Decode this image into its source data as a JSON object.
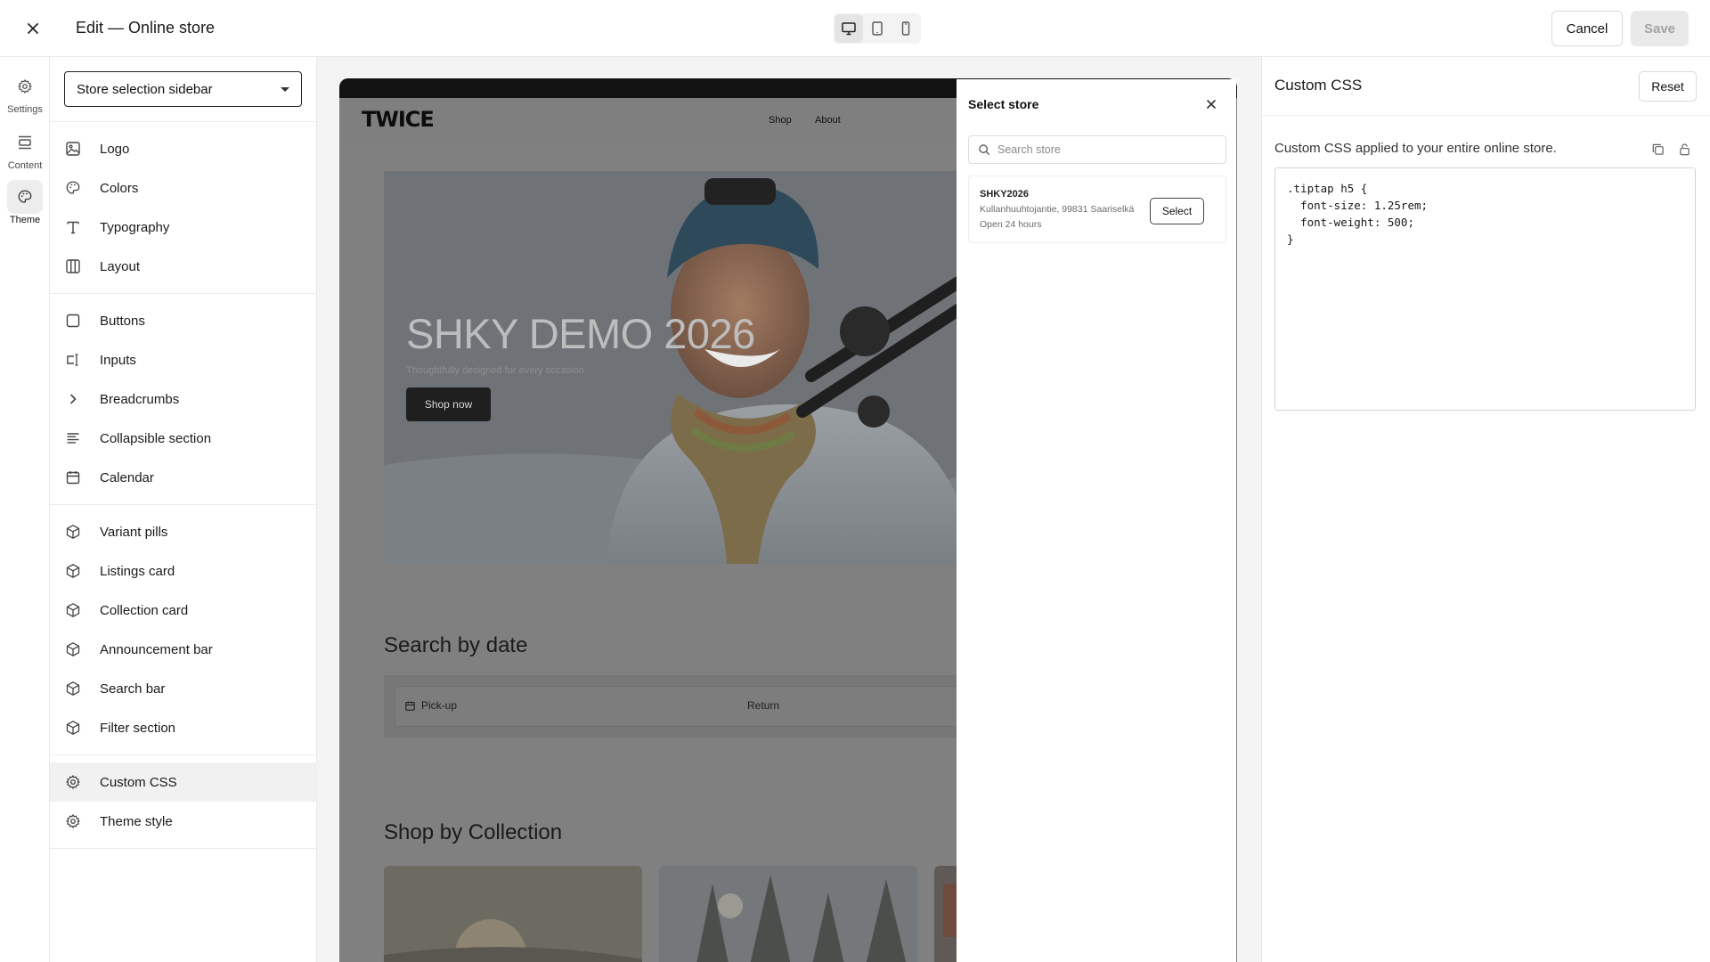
{
  "topbar": {
    "title": "Edit — Online store",
    "device_modes": [
      "desktop",
      "tablet",
      "mobile"
    ],
    "active_device": "desktop",
    "cancel_label": "Cancel",
    "save_label": "Save"
  },
  "rail": {
    "items": [
      {
        "label": "Settings",
        "icon": "gear-icon"
      },
      {
        "label": "Content",
        "icon": "content-icon"
      },
      {
        "label": "Theme",
        "icon": "palette-icon",
        "active": true
      }
    ]
  },
  "sidebar": {
    "dropdown_value": "Store selection sidebar",
    "groups": [
      [
        {
          "label": "Logo",
          "icon": "image-icon"
        },
        {
          "label": "Colors",
          "icon": "palette-icon"
        },
        {
          "label": "Typography",
          "icon": "type-icon"
        },
        {
          "label": "Layout",
          "icon": "columns-icon"
        }
      ],
      [
        {
          "label": "Buttons",
          "icon": "square-icon"
        },
        {
          "label": "Inputs",
          "icon": "input-cursor-icon"
        },
        {
          "label": "Breadcrumbs",
          "icon": "chevron-right-icon"
        },
        {
          "label": "Collapsible section",
          "icon": "align-left-icon"
        },
        {
          "label": "Calendar",
          "icon": "calendar-icon"
        }
      ],
      [
        {
          "label": "Variant pills",
          "icon": "box-icon"
        },
        {
          "label": "Listings card",
          "icon": "box-icon"
        },
        {
          "label": "Collection card",
          "icon": "box-icon"
        },
        {
          "label": "Announcement bar",
          "icon": "box-icon"
        },
        {
          "label": "Search bar",
          "icon": "box-icon"
        },
        {
          "label": "Filter section",
          "icon": "box-icon"
        }
      ],
      [
        {
          "label": "Custom CSS",
          "icon": "gear-icon",
          "active": true
        },
        {
          "label": "Theme style",
          "icon": "gear-icon"
        }
      ]
    ]
  },
  "preview": {
    "logo": "TWICE",
    "nav": [
      "Shop",
      "About"
    ],
    "hero_title": "SHKY DEMO 2026",
    "hero_subtitle": "Thoughtfully designed for every occasion",
    "hero_button": "Shop now",
    "search_by_date_title": "Search by date",
    "pickup_label": "Pick-up",
    "return_label": "Return",
    "collection_title": "Shop by Collection"
  },
  "store_drawer": {
    "title": "Select store",
    "search_placeholder": "Search store",
    "stores": [
      {
        "name": "SHKY2026",
        "address": "Kullanhuuhtojantie, 99831 Saariselkä",
        "hours": "Open 24 hours",
        "button": "Select"
      }
    ]
  },
  "custom_css": {
    "title": "Custom CSS",
    "reset_label": "Reset",
    "description": "Custom CSS applied to your entire online store.",
    "code_lines": [
      ".tiptap h5 {",
      "  font-size: 1.25rem;",
      "  font-weight: 500;",
      "}"
    ]
  },
  "colors": {
    "accent": "#111111",
    "overlay": "#808080",
    "save_disabled_bg": "#e9e9e9",
    "save_disabled_text": "#a3a3a3"
  }
}
